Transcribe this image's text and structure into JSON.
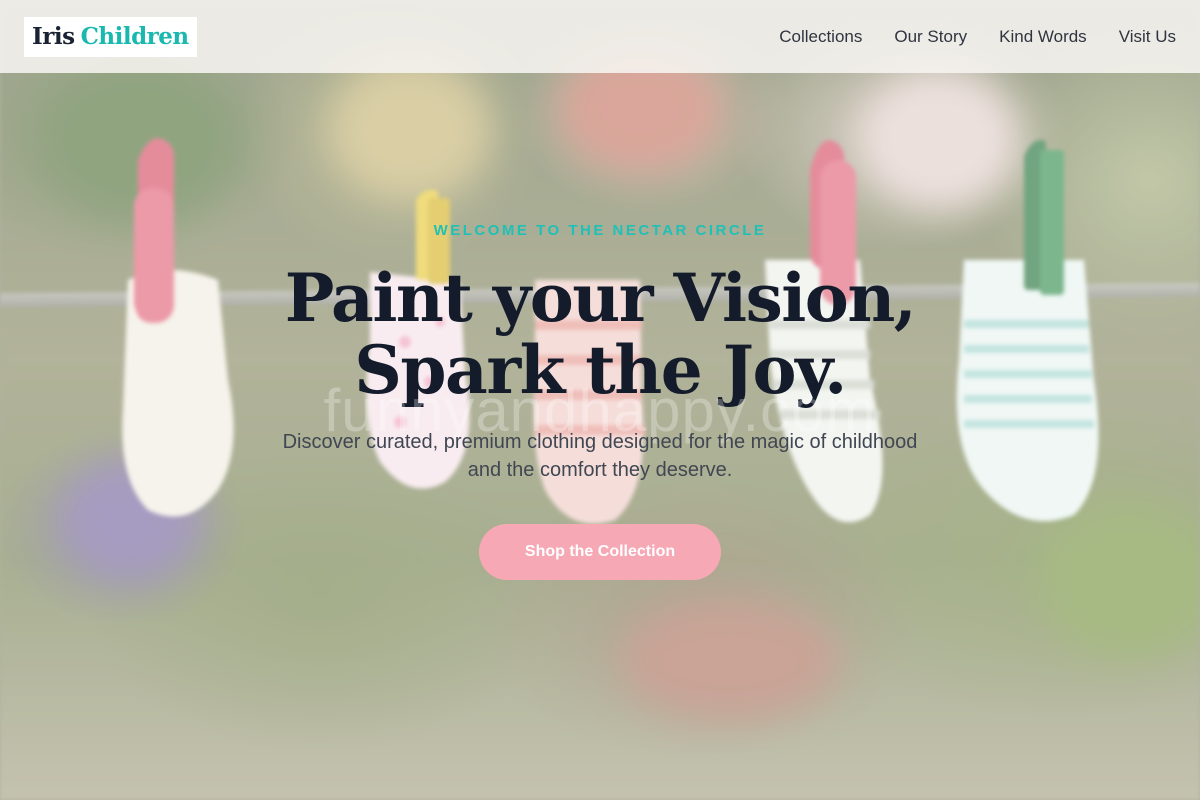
{
  "brand": {
    "part1": "Iris",
    "part2": "Children",
    "accent_color": "#19b9b0",
    "dark_color": "#1a2332"
  },
  "nav": {
    "items": [
      "Collections",
      "Our Story",
      "Kind Words",
      "Visit Us"
    ]
  },
  "hero": {
    "eyebrow": "WELCOME TO THE NECTAR CIRCLE",
    "headline_line1": "Paint your Vision,",
    "headline_line2": "Spark the Joy.",
    "subtext": "Discover curated, premium clothing designed for the magic of childhood and the comfort they deserve.",
    "cta_label": "Shop the Collection",
    "cta_color": "#f7a8b5",
    "watermark": "funnyandhappy.com"
  },
  "background": {
    "description_icon": "socks-on-clothesline-photo"
  }
}
